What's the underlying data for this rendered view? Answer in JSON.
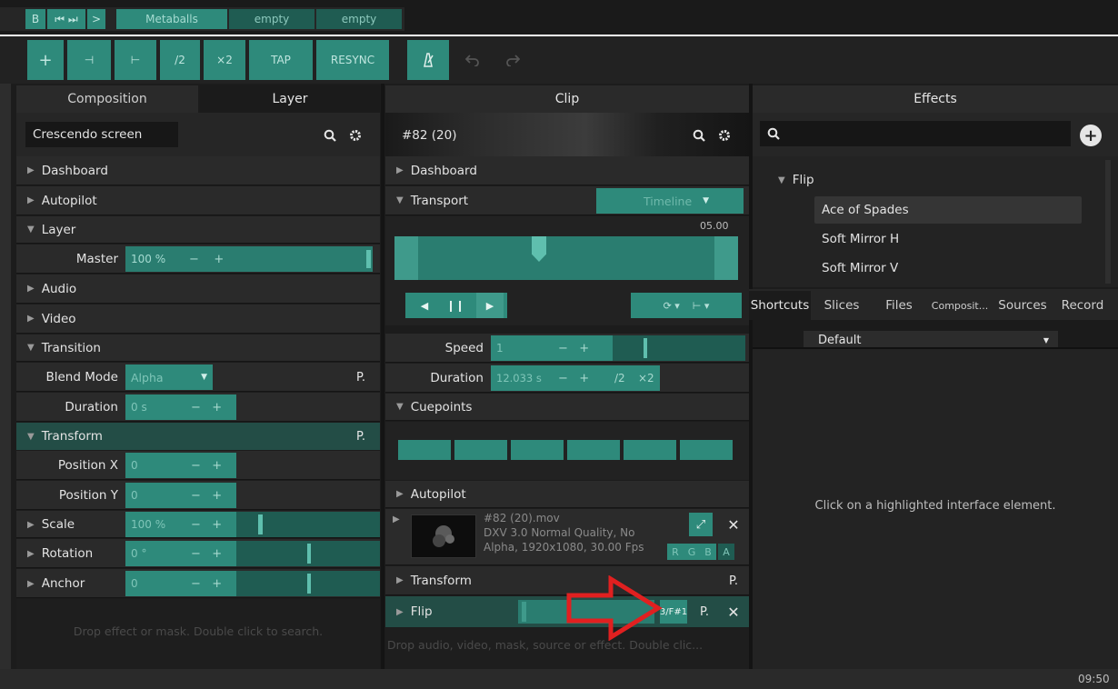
{
  "topbar": {
    "b_label": "B",
    "skip_label": "⏮ ⏭",
    "play_label": ">",
    "decks": [
      "Metaballs",
      "empty",
      "empty"
    ]
  },
  "toolbar": {
    "plus": "+",
    "prev": "⊣",
    "next": "⊢",
    "half": "/2",
    "double": "×2",
    "tap": "TAP",
    "resync": "RESYNC"
  },
  "left_panel": {
    "tab_composition": "Composition",
    "tab_layer": "Layer",
    "layer_name": "Crescendo screen",
    "sections": {
      "dashboard": "Dashboard",
      "autopilot": "Autopilot",
      "layer": "Layer",
      "audio": "Audio",
      "video": "Video",
      "transition": "Transition",
      "transform": "Transform"
    },
    "master": {
      "label": "Master",
      "value": "100 %",
      "level": 1.0
    },
    "blend_mode": {
      "label": "Blend Mode",
      "value": "Alpha",
      "p": "P."
    },
    "duration": {
      "label": "Duration",
      "value": "0 s"
    },
    "transform_p": "P.",
    "position_x": {
      "label": "Position X",
      "value": "0"
    },
    "position_y": {
      "label": "Position Y",
      "value": "0"
    },
    "scale": {
      "label": "Scale",
      "value": "100 %",
      "level": 0.25
    },
    "rotation": {
      "label": "Rotation",
      "value": "0 °",
      "level": 0.5
    },
    "anchor": {
      "label": "Anchor",
      "value": "0",
      "level": 0.5
    },
    "drop_hint": "Drop effect or mask. Double click to search."
  },
  "clip_panel": {
    "title": "Clip",
    "clip_name": "#82 (20)",
    "dashboard": "Dashboard",
    "transport": "Transport",
    "timeline_dropdown": "Timeline",
    "time": "05.00",
    "speed": {
      "label": "Speed",
      "value": "1"
    },
    "duration": {
      "label": "Duration",
      "value": "12.033 s",
      "half": "/2",
      "double": "×2"
    },
    "cuepoints": "Cuepoints",
    "autopilot": "Autopilot",
    "file": {
      "name": "#82 (20).mov",
      "codec": "DXV 3.0 Normal Quality, No",
      "details": "Alpha, 1920x1080, 30.00 Fps",
      "channels": [
        "R",
        "G",
        "B",
        "A"
      ]
    },
    "transform": "Transform",
    "transform_p": "P.",
    "flip": "Flip",
    "flip_badge": "3/F#1",
    "flip_p": "P.",
    "drop_hint": "Drop audio, video, mask, source or effect. Double clic..."
  },
  "effects_panel": {
    "title": "Effects",
    "group": "Flip",
    "items": [
      "Ace of Spades",
      "Soft Mirror H",
      "Soft Mirror V"
    ],
    "tabs": [
      "Shortcuts",
      "Slices",
      "Files",
      "Composit...",
      "Sources",
      "Record"
    ],
    "shortcuts_dropdown": "Default",
    "hint": "Click on a highlighted interface element."
  },
  "status": {
    "time": "09:50"
  },
  "colors": {
    "teal": "#2e8a7b",
    "annotation_arrow": "#e02020"
  }
}
